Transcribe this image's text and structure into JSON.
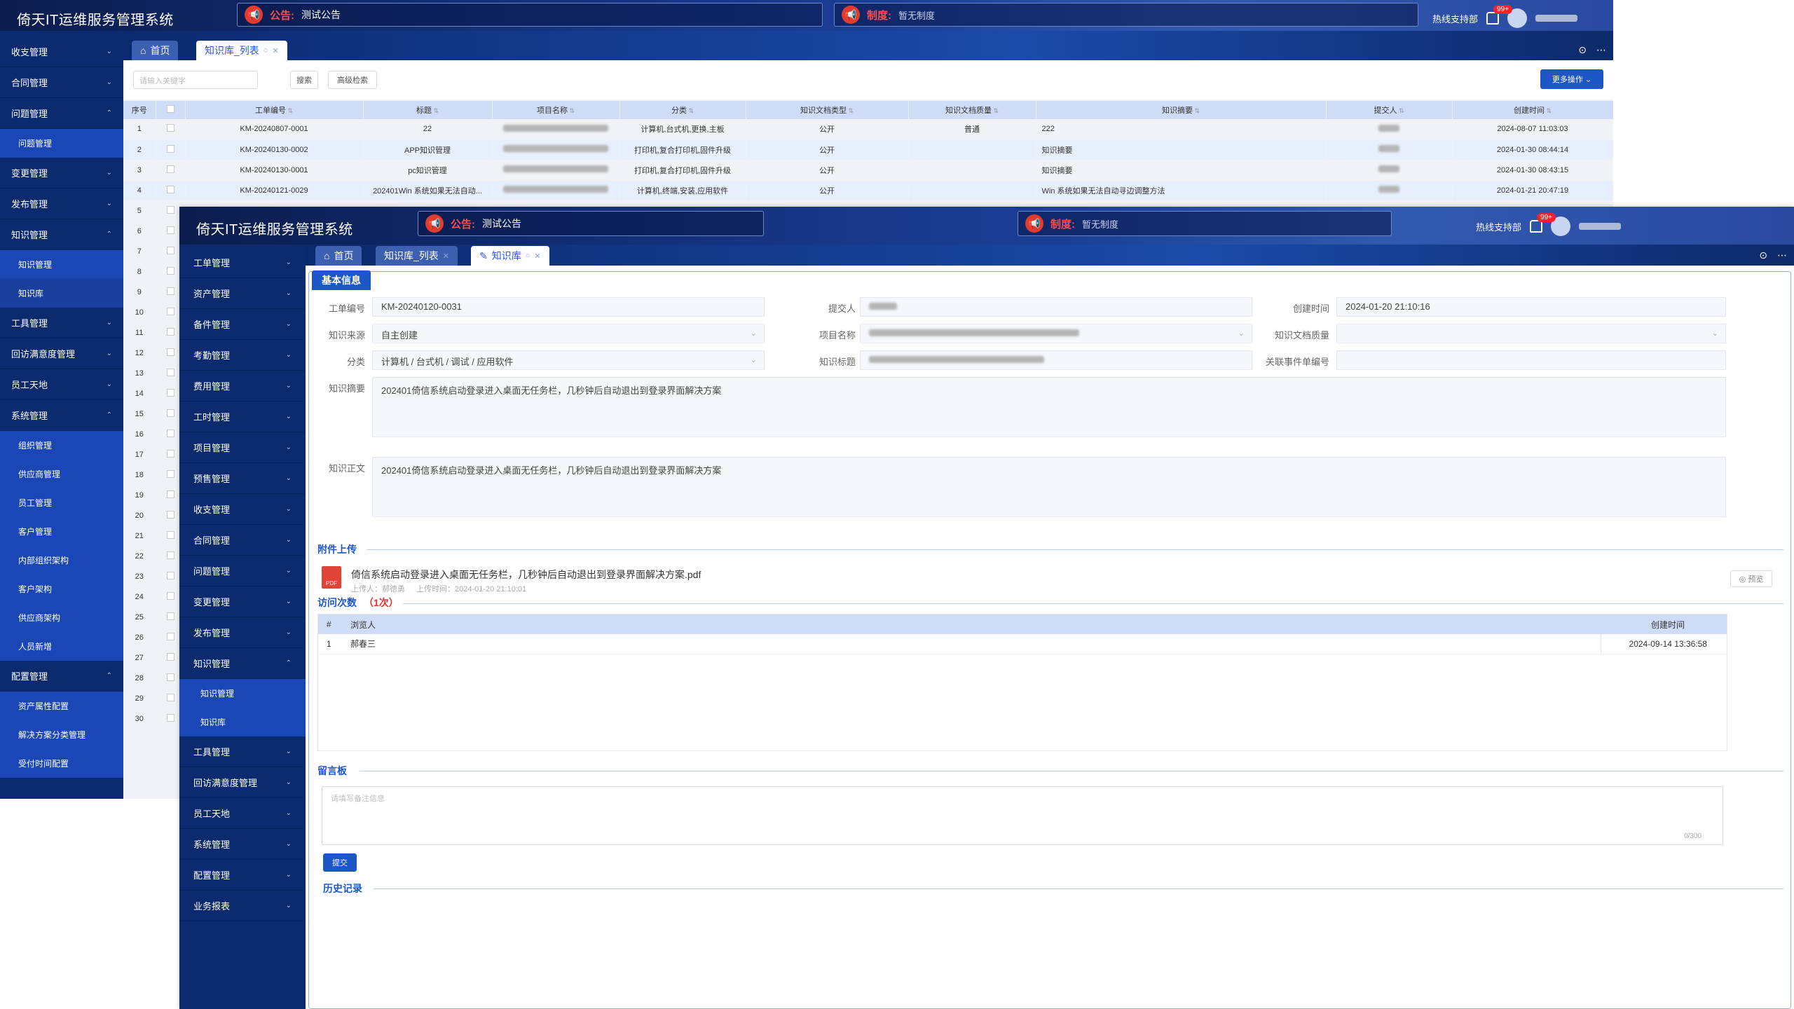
{
  "app_title": "倚天IT运维服务管理系统",
  "notice": {
    "label": "公告:",
    "text": "测试公告"
  },
  "rule": {
    "label": "制度:",
    "text": "暂无制度"
  },
  "hotline": "热线支持部",
  "badge": "99+",
  "win1": {
    "tabs": [
      "首页",
      "知识库_列表"
    ],
    "sidebar": [
      {
        "label": "收支管理",
        "type": "menu"
      },
      {
        "label": "合同管理",
        "type": "menu"
      },
      {
        "label": "问题管理",
        "type": "open"
      },
      {
        "label": "问题管理",
        "type": "sub"
      },
      {
        "label": "变更管理",
        "type": "menu"
      },
      {
        "label": "发布管理",
        "type": "menu"
      },
      {
        "label": "知识管理",
        "type": "open"
      },
      {
        "label": "知识管理",
        "type": "sub"
      },
      {
        "label": "知识库",
        "type": "subsel"
      },
      {
        "label": "工具管理",
        "type": "menu"
      },
      {
        "label": "回访满意度管理",
        "type": "menu"
      },
      {
        "label": "员工天地",
        "type": "menu"
      },
      {
        "label": "系统管理",
        "type": "open"
      },
      {
        "label": "组织管理",
        "type": "sub"
      },
      {
        "label": "供应商管理",
        "type": "sub"
      },
      {
        "label": "员工管理",
        "type": "sub"
      },
      {
        "label": "客户管理",
        "type": "sub"
      },
      {
        "label": "内部组织架构",
        "type": "sub"
      },
      {
        "label": "客户架构",
        "type": "sub"
      },
      {
        "label": "供应商架构",
        "type": "sub"
      },
      {
        "label": "人员新增",
        "type": "sub"
      },
      {
        "label": "配置管理",
        "type": "open"
      },
      {
        "label": "资产属性配置",
        "type": "sub"
      },
      {
        "label": "解决方案分类管理",
        "type": "sub"
      },
      {
        "label": "受付时间配置",
        "type": "sub"
      }
    ],
    "search_placeholder": "请输入关键字",
    "search_btn": "搜索",
    "adv_btn": "高级检索",
    "more_btn": "更多操作",
    "columns": [
      "序号",
      "",
      "工单编号",
      "标题",
      "项目名称",
      "分类",
      "知识文档类型",
      "知识文档质量",
      "知识摘要",
      "提交人",
      "创建时间"
    ],
    "rows": [
      {
        "no": "1",
        "code": "KM-20240807-0001",
        "title": "22",
        "cat": "计算机,台式机,更换,主板",
        "type": "公开",
        "quality": "普通",
        "summary": "222",
        "time": "2024-08-07 11:03:03"
      },
      {
        "no": "2",
        "code": "KM-20240130-0002",
        "title": "APP知识管理",
        "cat": "打印机,复合打印机,固件升级",
        "type": "公开",
        "quality": "",
        "summary": "知识摘要",
        "time": "2024-01-30 08:44:14"
      },
      {
        "no": "3",
        "code": "KM-20240130-0001",
        "title": "pc知识管理",
        "cat": "打印机,复合打印机,固件升级",
        "type": "公开",
        "quality": "",
        "summary": "知识摘要",
        "time": "2024-01-30 08:43:15"
      },
      {
        "no": "4",
        "code": "KM-20240121-0029",
        "title": "202401Win 系统如果无法自动...",
        "cat": "计算机,终端,安装,应用软件",
        "type": "公开",
        "quality": "",
        "summary": "Win 系统如果无法自动寻边调整方法",
        "time": "2024-01-21 20:47:19"
      }
    ],
    "row_numbers": [
      "5",
      "6",
      "7",
      "8",
      "9",
      "10",
      "11",
      "12",
      "13",
      "14",
      "15",
      "16",
      "17",
      "18",
      "19",
      "20",
      "21",
      "22",
      "23",
      "24",
      "25",
      "26",
      "27",
      "28",
      "29",
      "30"
    ]
  },
  "win2": {
    "tabs": [
      "首页",
      "知识库_列表",
      "知识库"
    ],
    "sidebar": [
      {
        "label": "工单管理",
        "type": "menu"
      },
      {
        "label": "资产管理",
        "type": "menu"
      },
      {
        "label": "备件管理",
        "type": "menu"
      },
      {
        "label": "考勤管理",
        "type": "menu"
      },
      {
        "label": "费用管理",
        "type": "menu"
      },
      {
        "label": "工时管理",
        "type": "menu"
      },
      {
        "label": "项目管理",
        "type": "menu"
      },
      {
        "label": "预售管理",
        "type": "menu"
      },
      {
        "label": "收支管理",
        "type": "menu"
      },
      {
        "label": "合同管理",
        "type": "menu"
      },
      {
        "label": "问题管理",
        "type": "menu"
      },
      {
        "label": "变更管理",
        "type": "menu"
      },
      {
        "label": "发布管理",
        "type": "menu"
      },
      {
        "label": "知识管理",
        "type": "open"
      },
      {
        "label": "知识管理",
        "type": "sub"
      },
      {
        "label": "知识库",
        "type": "sub"
      },
      {
        "label": "工具管理",
        "type": "menu"
      },
      {
        "label": "回访满意度管理",
        "type": "menu"
      },
      {
        "label": "员工天地",
        "type": "menu"
      },
      {
        "label": "系统管理",
        "type": "menu"
      },
      {
        "label": "配置管理",
        "type": "menu"
      },
      {
        "label": "业务报表",
        "type": "menu"
      }
    ],
    "section": "基本信息",
    "fields": {
      "code_lbl": "工单编号",
      "code": "KM-20240120-0031",
      "submitter_lbl": "提交人",
      "created_lbl": "创建时间",
      "created": "2024-01-20 21:10:16",
      "source_lbl": "知识来源",
      "source": "自主创建",
      "project_lbl": "项目名称",
      "quality_lbl": "知识文档质量",
      "cat_lbl": "分类",
      "cat": "计算机 / 台式机 / 调试 / 应用软件",
      "ktitle_lbl": "知识标题",
      "event_lbl": "关联事件单编号",
      "summary_lbl": "知识摘要",
      "summary": "202401倚信系统启动登录进入桌面无任务栏，几秒钟后自动退出到登录界面解决方案",
      "body_lbl": "知识正文",
      "body": "202401倚信系统启动登录进入桌面无任务栏，几秒钟后自动退出到登录界面解决方案"
    },
    "attach_title": "附件上传",
    "attach": {
      "name": "倚信系统启动登录进入桌面无任务栏，几秒钟后自动退出到登录界面解决方案.pdf",
      "uploader": "上传人：郝德勇",
      "time": "上传时间：2024-01-20 21:10:01",
      "preview": "预览",
      "icon": "PDF"
    },
    "visits_title": "访问次数",
    "visits_count": "（1次）",
    "visit_cols": [
      "#",
      "浏览人",
      "创建时间"
    ],
    "visit_rows": [
      {
        "no": "1",
        "name": "郝春三",
        "time": "2024-09-14 13:36:58"
      }
    ],
    "msg_title": "留言板",
    "msg_placeholder": "请填写备注信息",
    "msg_count": "0/300",
    "submit": "提交",
    "history_title": "历史记录"
  }
}
